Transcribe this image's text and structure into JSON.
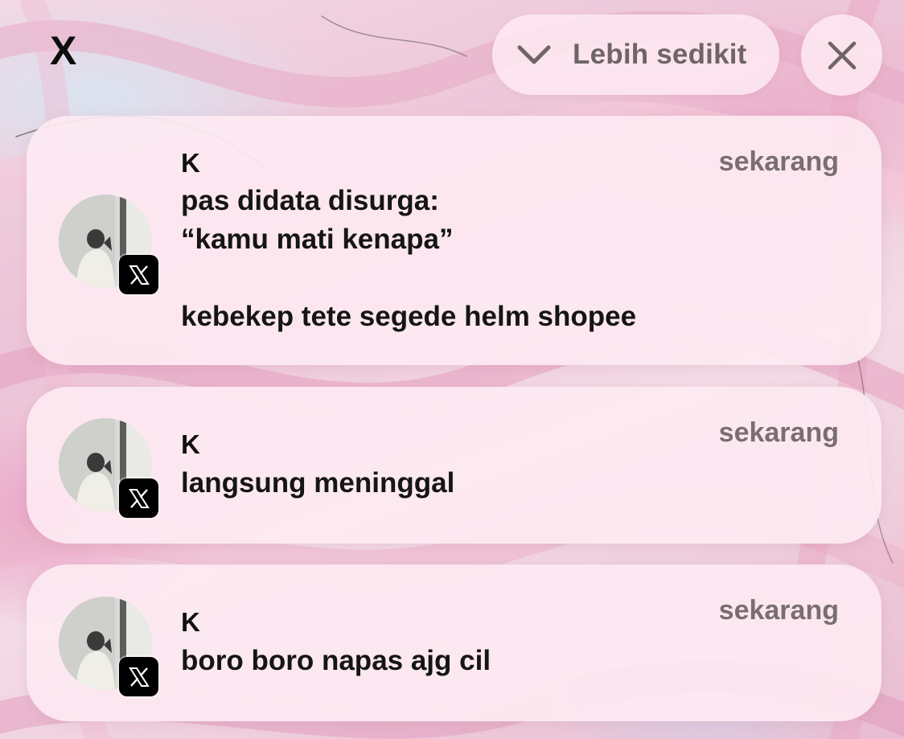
{
  "header": {
    "app_title": "X",
    "collapse_label": "Lebih sedikit"
  },
  "notifications": [
    {
      "sender": "K",
      "time": "sekarang",
      "lines": [
        "pas didata disurga:",
        "“kamu mati kenapa”",
        "",
        "kebekep tete segede helm shopee"
      ]
    },
    {
      "sender": "K",
      "time": "sekarang",
      "lines": [
        "langsung meninggal"
      ]
    },
    {
      "sender": "K",
      "time": "sekarang",
      "lines": [
        "boro boro napas ajg cil"
      ]
    }
  ],
  "icons": {
    "collapse": "chevron-down-icon",
    "close": "close-icon",
    "app_badge": "x-logo-icon"
  },
  "colors": {
    "card_background": "#fde9f1",
    "muted_text": "#7a6e72",
    "primary_text": "#151515",
    "badge": "#000000"
  }
}
